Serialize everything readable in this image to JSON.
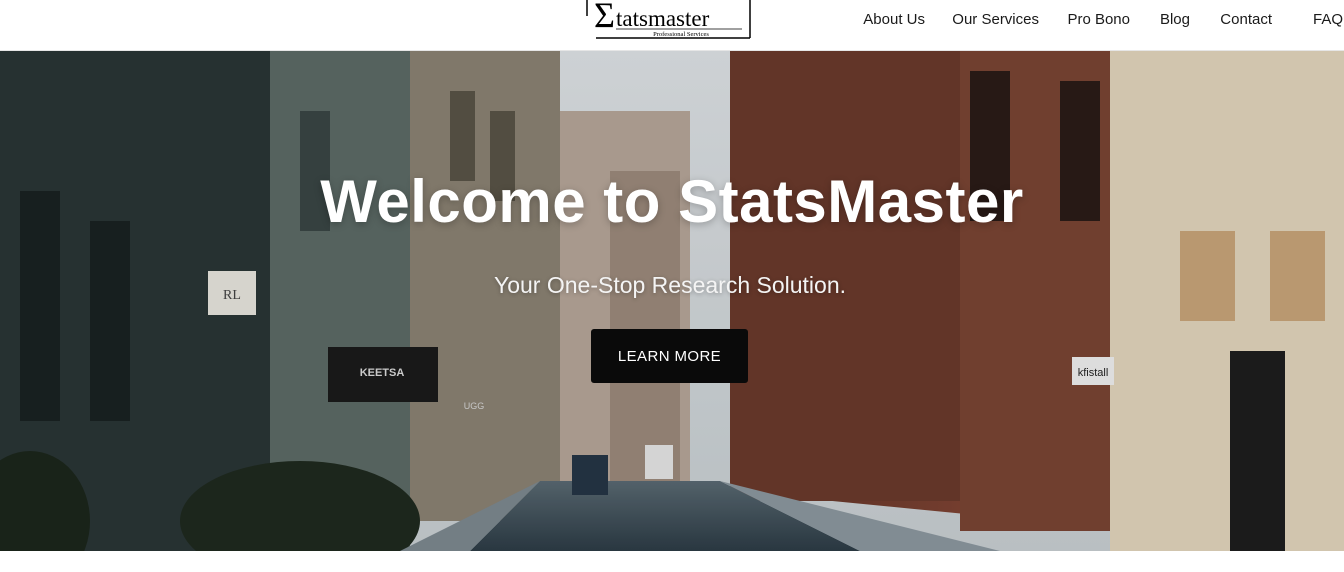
{
  "brand": {
    "logo_name": "tatsmaster",
    "logo_sigma": "Σ",
    "logo_tagline": "Professional Services"
  },
  "nav": {
    "items": [
      {
        "label": "About Us"
      },
      {
        "label": "Our Services"
      },
      {
        "label": "Pro Bono"
      },
      {
        "label": "Blog"
      },
      {
        "label": "Contact"
      },
      {
        "label": "FAQ"
      }
    ]
  },
  "hero": {
    "title": "Welcome to StatsMaster",
    "subtitle": "Your One-Stop Research Solution.",
    "button_label": "LEARN MORE",
    "storefront_signs": [
      "KEETSA",
      "kfistall",
      "RL",
      "UGG"
    ]
  },
  "colors": {
    "header_bg": "#ffffff",
    "nav_text": "#1a1a1a",
    "button_bg": "#0a0a0a",
    "hero_text": "#ffffff"
  }
}
